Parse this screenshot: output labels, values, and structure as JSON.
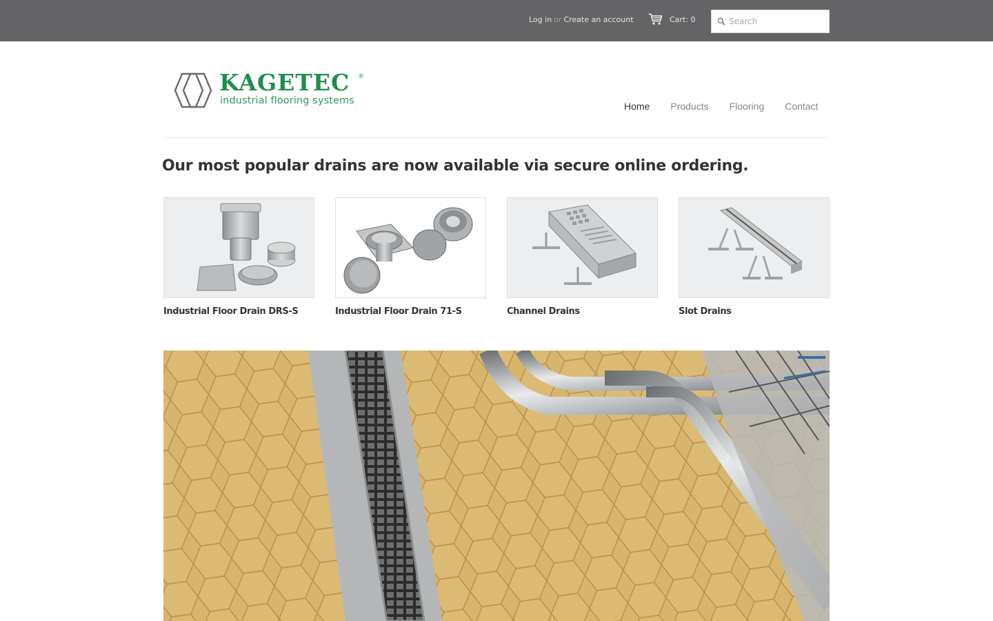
{
  "topbar": {
    "login": "Log in",
    "or": "or",
    "create_account": "Create an account",
    "cart_label": "Cart: 0",
    "search_placeholder": "Search"
  },
  "brand": {
    "name": "KAGETEC",
    "registered": "®",
    "tagline": "industrial flooring systems",
    "color": "#1d8f4a"
  },
  "nav": {
    "items": [
      {
        "label": "Home",
        "active": true
      },
      {
        "label": "Products",
        "active": false
      },
      {
        "label": "Flooring",
        "active": false
      },
      {
        "label": "Contact",
        "active": false
      }
    ]
  },
  "main": {
    "headline": "Our most popular drains are now available via secure online ordering.",
    "products": [
      {
        "title": "Industrial Floor Drain DRS-S"
      },
      {
        "title": "Industrial Floor Drain 71-S"
      },
      {
        "title": "Channel Drains"
      },
      {
        "title": "Slot Drains"
      }
    ]
  },
  "colors": {
    "topbar_bg": "#646466",
    "tile_yellow": "#d4b26a",
    "steel": "#b5b8bb"
  }
}
